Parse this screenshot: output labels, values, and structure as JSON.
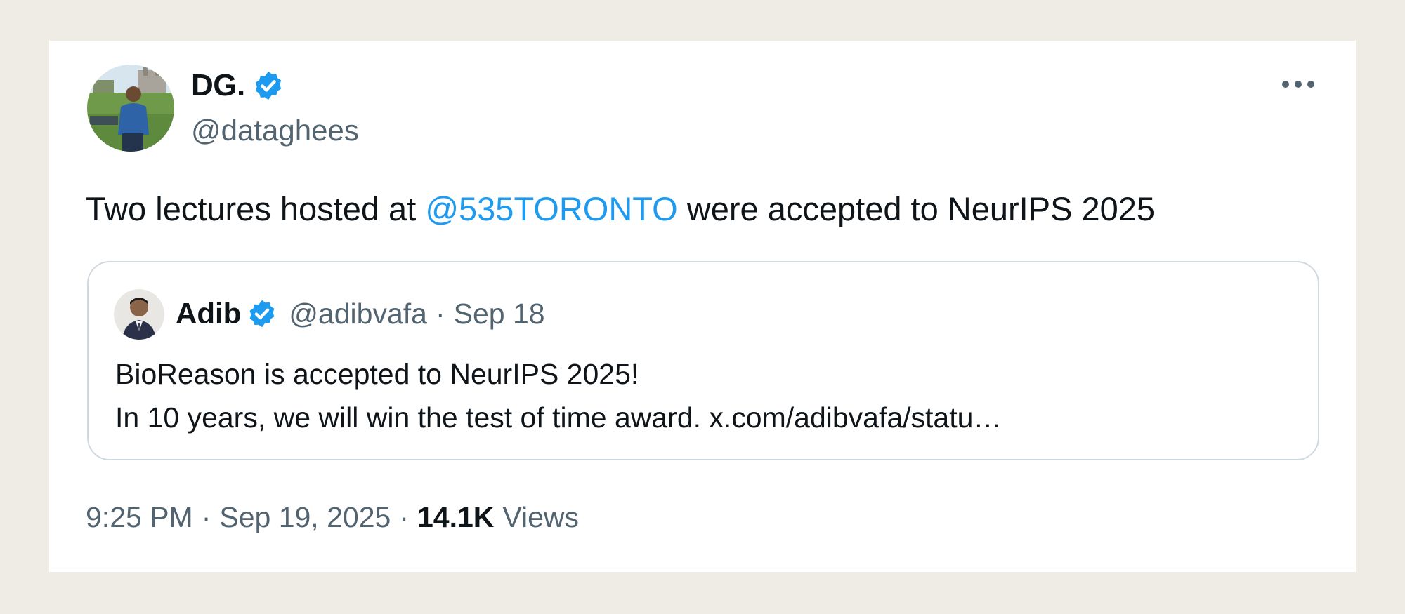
{
  "tweet": {
    "author": {
      "display_name": "DG.",
      "handle": "@dataghees",
      "verified": true
    },
    "text": {
      "before": "Two lectures hosted at ",
      "mention": "@535TORONTO",
      "after": " were accepted to NeurIPS 2025"
    },
    "more_icon": "more-horizontal-icon",
    "quote": {
      "author": {
        "display_name": "Adib",
        "handle": "@adibvafa",
        "verified": true
      },
      "separator": "·",
      "date": "Sep 18",
      "lines": [
        "BioReason is accepted to NeurIPS 2025!",
        "In 10 years, we will win the test of time award. x.com/adibvafa/statu…"
      ]
    },
    "footer": {
      "time": "9:25 PM",
      "separator": "·",
      "date": "Sep 19, 2025",
      "views_count": "14.1K",
      "views_label": "Views"
    }
  },
  "colors": {
    "background": "#efebe5",
    "card": "#ffffff",
    "accent": "#1d9bf0",
    "secondary_text": "#536471",
    "primary_text": "#0f1419",
    "border": "#cfd9de"
  }
}
